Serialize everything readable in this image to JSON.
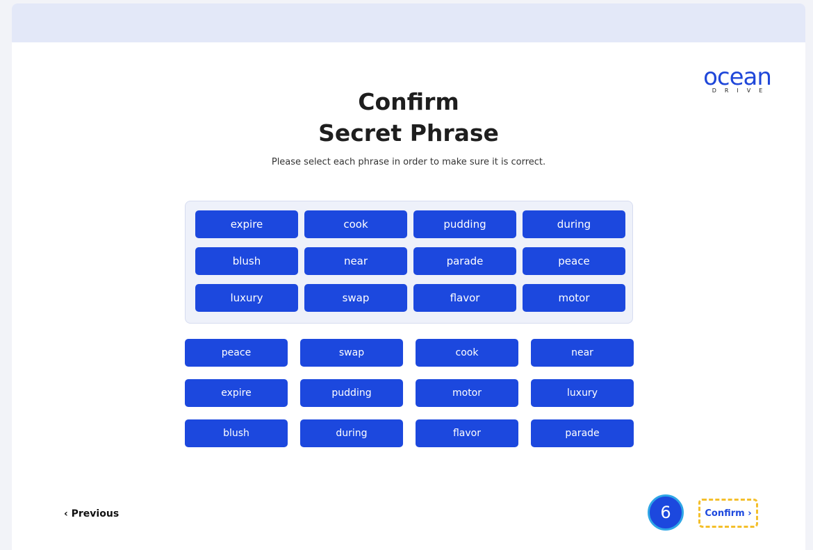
{
  "brand": {
    "logo_word": "ocean",
    "logo_sub": "DRIVE",
    "accent_color": "#1c48de",
    "highlight_color": "#f4bf2b"
  },
  "header": {
    "title_line1": "Confirm",
    "title_line2": "Secret Phrase",
    "subtitle": "Please select each phrase in order to make sure it is correct."
  },
  "selected_phrase": [
    "expire",
    "cook",
    "pudding",
    "during",
    "blush",
    "near",
    "parade",
    "peace",
    "luxury",
    "swap",
    "flavor",
    "motor"
  ],
  "word_choices": [
    "peace",
    "swap",
    "cook",
    "near",
    "expire",
    "pudding",
    "motor",
    "luxury",
    "blush",
    "during",
    "flavor",
    "parade"
  ],
  "footer": {
    "previous_label": "‹ Previous",
    "step_number": "6",
    "confirm_label": "Confirm ›"
  }
}
